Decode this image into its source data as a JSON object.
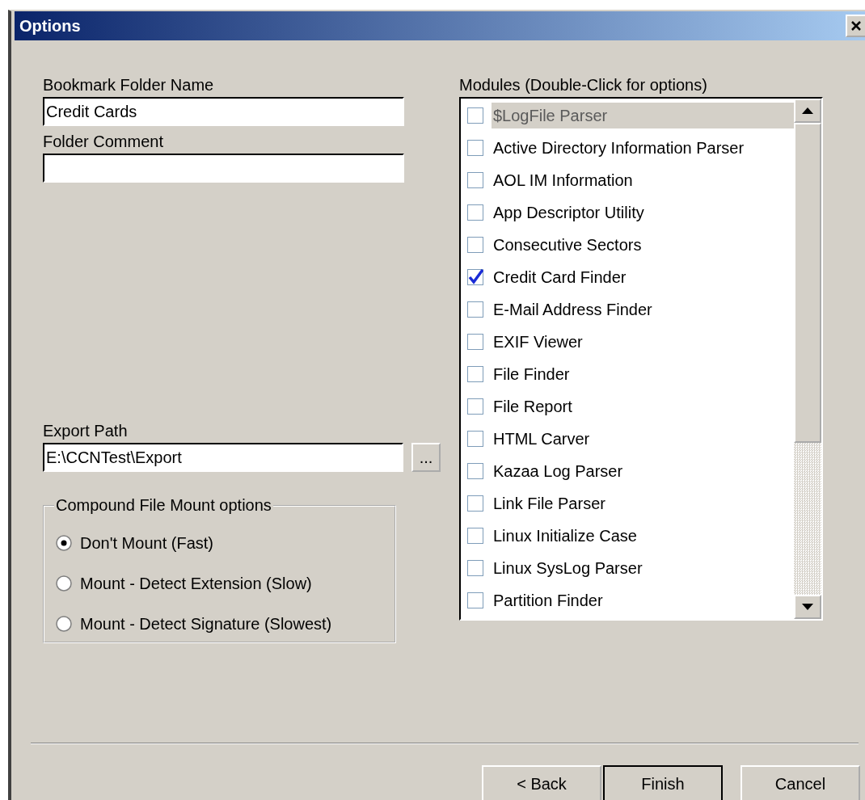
{
  "window": {
    "title": "Options"
  },
  "bookmark_folder_name": {
    "label": "Bookmark Folder Name",
    "value": "Credit Cards"
  },
  "folder_comment": {
    "label": "Folder Comment"
  },
  "export_path": {
    "label": "Export Path",
    "value": "E:\\CCNTest\\Export",
    "browse_button": "..."
  },
  "compound_file_mount": {
    "legend": "Compound File Mount options",
    "options": [
      {
        "label": "Don't Mount (Fast)",
        "selected": true
      },
      {
        "label": "Mount - Detect Extension (Slow)",
        "selected": false
      },
      {
        "label": "Mount - Detect Signature (Slowest)",
        "selected": false
      }
    ]
  },
  "modules": {
    "label": "Modules (Double-Click for options)",
    "items": [
      {
        "name": "$LogFile Parser",
        "checked": false,
        "selected": true
      },
      {
        "name": "Active Directory Information Parser",
        "checked": false,
        "selected": false
      },
      {
        "name": "AOL IM Information",
        "checked": false,
        "selected": false
      },
      {
        "name": "App Descriptor Utility",
        "checked": false,
        "selected": false
      },
      {
        "name": "Consecutive Sectors",
        "checked": false,
        "selected": false
      },
      {
        "name": "Credit Card Finder",
        "checked": true,
        "selected": false
      },
      {
        "name": "E-Mail Address Finder",
        "checked": false,
        "selected": false
      },
      {
        "name": "EXIF Viewer",
        "checked": false,
        "selected": false
      },
      {
        "name": "File Finder",
        "checked": false,
        "selected": false
      },
      {
        "name": "File Report",
        "checked": false,
        "selected": false
      },
      {
        "name": "HTML Carver",
        "checked": false,
        "selected": false
      },
      {
        "name": "Kazaa Log Parser",
        "checked": false,
        "selected": false
      },
      {
        "name": "Link File Parser",
        "checked": false,
        "selected": false
      },
      {
        "name": "Linux Initialize Case",
        "checked": false,
        "selected": false
      },
      {
        "name": "Linux SysLog Parser",
        "checked": false,
        "selected": false
      },
      {
        "name": "Partition Finder",
        "checked": false,
        "selected": false
      }
    ]
  },
  "buttons": [
    {
      "label": "< Back",
      "kind": "normal"
    },
    {
      "label": "Finish",
      "kind": "default"
    },
    {
      "label": "Cancel",
      "kind": "cancel"
    }
  ]
}
